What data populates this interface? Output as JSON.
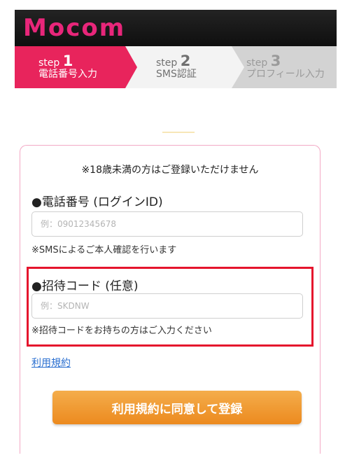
{
  "brand": {
    "logo_text": "Mocom",
    "color": "#e8267a"
  },
  "steps": [
    {
      "prefix": "step ",
      "number": "1",
      "label": "電話番号入力",
      "state": "active"
    },
    {
      "prefix": "step ",
      "number": "2",
      "label": "SMS認証",
      "state": "next"
    },
    {
      "prefix": "step ",
      "number": "3",
      "label": "プロフィール入力",
      "state": "upcoming"
    }
  ],
  "form": {
    "notice": "※18歳未満の方はご登録いただけません",
    "phone": {
      "label": "●電話番号 (ログインID)",
      "placeholder": "例：09012345678",
      "value": "",
      "help": "※SMSによるご本人確認を行います"
    },
    "invite": {
      "label": "●招待コード (任意)",
      "placeholder": "例：SKDNW",
      "value": "",
      "help": "※招待コードをお持ちの方はご入力ください"
    },
    "terms_link": "利用規約",
    "submit_label": "利用規約に同意して登録"
  },
  "colors": {
    "step_active": "#e8245c",
    "highlight_border": "#e5152d",
    "button": "#ec8a1f",
    "link": "#2a6fd0"
  }
}
